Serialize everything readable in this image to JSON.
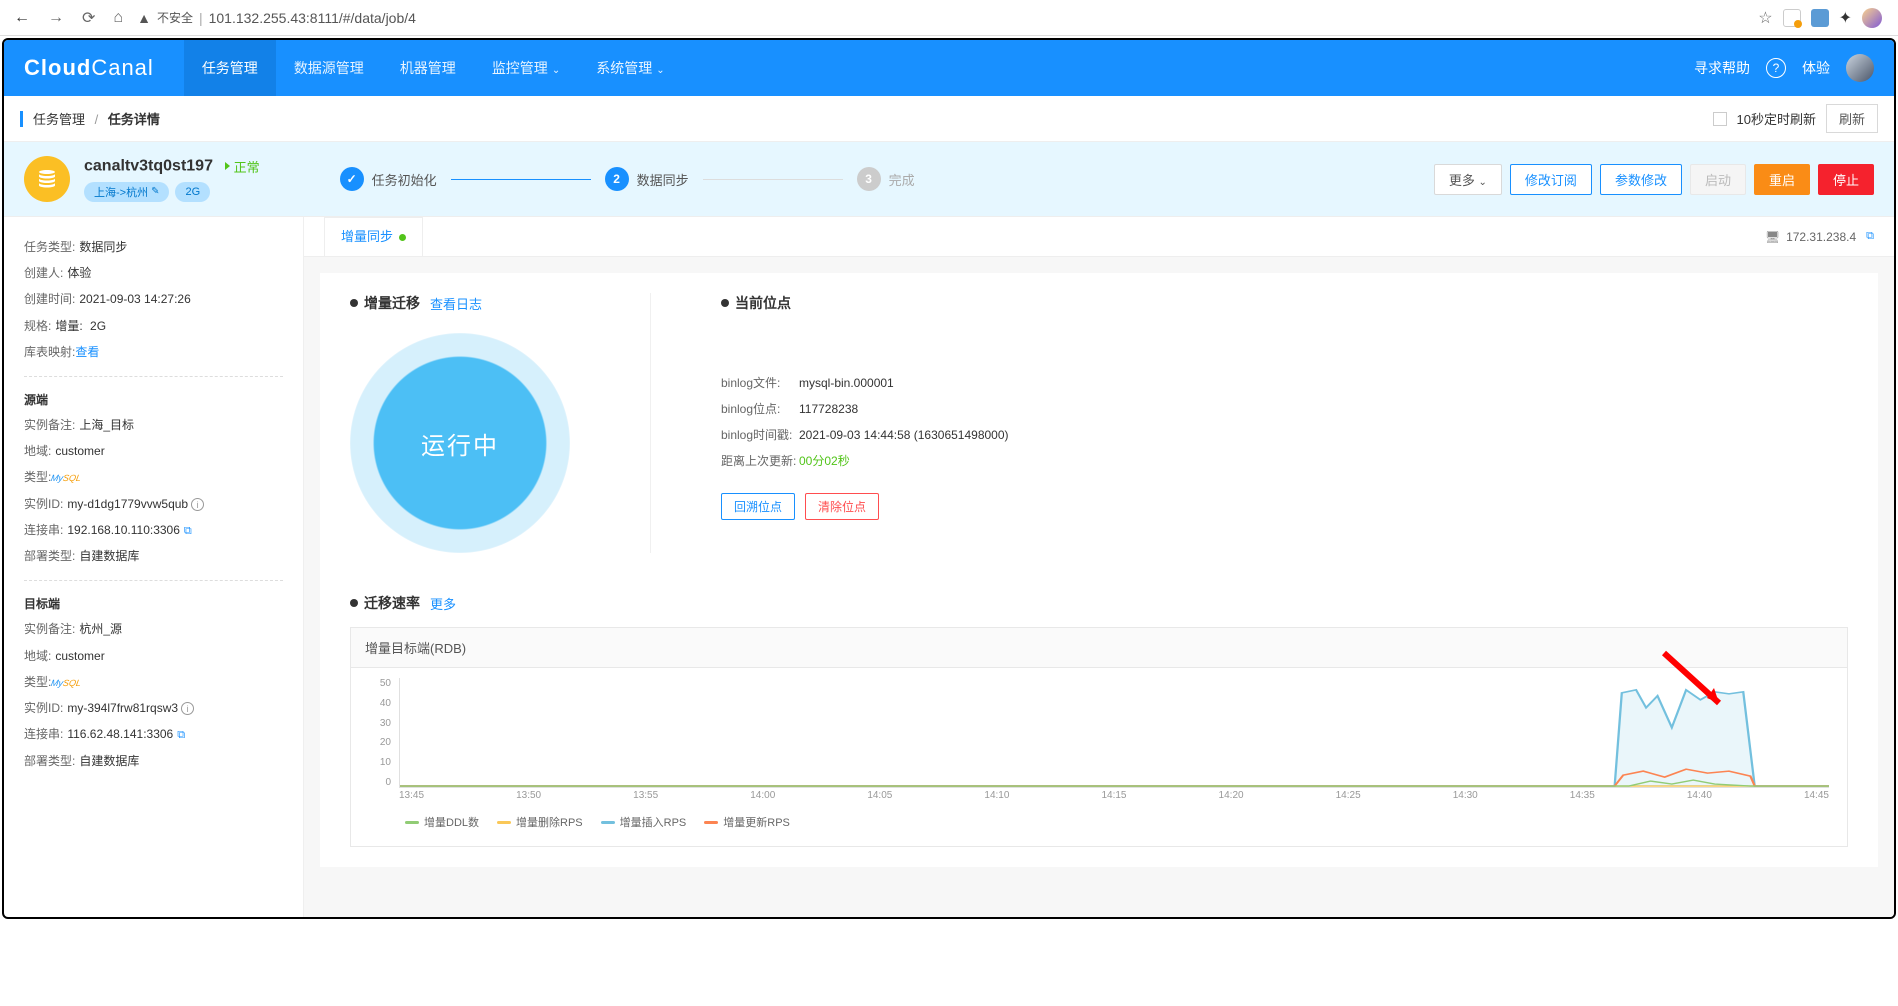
{
  "browser": {
    "url_prefix": "不安全",
    "url": "101.132.255.43:8111/#/data/job/4"
  },
  "header": {
    "logo_a": "Cloud",
    "logo_b": "Canal",
    "nav": [
      "任务管理",
      "数据源管理",
      "机器管理",
      "监控管理",
      "系统管理"
    ],
    "help": "寻求帮助",
    "user_label": "体验"
  },
  "breadcrumb": {
    "root": "任务管理",
    "current": "任务详情"
  },
  "bc_actions": {
    "auto_refresh": "10秒定时刷新",
    "refresh": "刷新"
  },
  "banner": {
    "job_name": "canaltv3tq0st197",
    "status": "正常",
    "tags": {
      "route": "上海->杭州",
      "spec": "2G"
    },
    "steps": {
      "s1": "任务初始化",
      "s2": "数据同步",
      "s3": "完成"
    },
    "btns": {
      "more": "更多",
      "sub": "修改订阅",
      "param": "参数修改",
      "start": "启动",
      "restart": "重启",
      "stop": "停止"
    }
  },
  "sidebar": {
    "task_type_lbl": "任务类型:",
    "task_type": "数据同步",
    "creator_lbl": "创建人:",
    "creator": "体验",
    "ctime_lbl": "创建时间:",
    "ctime": "2021-09-03 14:27:26",
    "spec_lbl": "规格:",
    "spec_k": "增量:",
    "spec_v": "2G",
    "mapping_lbl": "库表映射:",
    "mapping_link": "查看",
    "src_heading": "源端",
    "src": {
      "remark_lbl": "实例备注:",
      "remark": "上海_目标",
      "region_lbl": "地域:",
      "region": "customer",
      "type_lbl": "类型:",
      "type": "MySQL",
      "id_lbl": "实例ID:",
      "id": "my-d1dg1779vvw5qub",
      "conn_lbl": "连接串:",
      "conn": "192.168.10.110:3306",
      "deploy_lbl": "部署类型:",
      "deploy": "自建数据库"
    },
    "dst_heading": "目标端",
    "dst": {
      "remark_lbl": "实例备注:",
      "remark": "杭州_源",
      "region_lbl": "地域:",
      "region": "customer",
      "type_lbl": "类型:",
      "type": "MySQL",
      "id_lbl": "实例ID:",
      "id": "my-394l7frw81rqsw3",
      "conn_lbl": "连接串:",
      "conn": "116.62.48.141:3306",
      "deploy_lbl": "部署类型:",
      "deploy": "自建数据库"
    }
  },
  "tab": {
    "label": "增量同步",
    "server_ip": "172.31.238.4"
  },
  "migrate": {
    "title": "增量迁移",
    "log_link": "查看日志",
    "status": "运行中"
  },
  "position": {
    "title": "当前位点",
    "file_lbl": "binlog文件:",
    "file": "mysql-bin.000001",
    "pos_lbl": "binlog位点:",
    "pos": "117728238",
    "ts_lbl": "binlog时间戳:",
    "ts": "2021-09-03 14:44:58  (1630651498000)",
    "since_lbl": "距离上次更新:",
    "since": "00分02秒",
    "btn_rollback": "回溯位点",
    "btn_clear": "清除位点"
  },
  "rate": {
    "title": "迁移速率",
    "more": "更多"
  },
  "chart_data": {
    "type": "line",
    "title": "增量目标端(RDB)",
    "ylabel": "",
    "ylim": [
      0,
      50
    ],
    "y_ticks": [
      "50",
      "40",
      "30",
      "20",
      "10",
      "0"
    ],
    "x_ticks": [
      "13:45",
      "13:50",
      "13:55",
      "14:00",
      "14:05",
      "14:10",
      "14:15",
      "14:20",
      "14:25",
      "14:30",
      "14:35",
      "14:40",
      "14:45"
    ],
    "series": [
      {
        "name": "增量DDL数",
        "color": "#91cc75",
        "values_desc": "flat 0, brief pulse ~14:38"
      },
      {
        "name": "增量删除RPS",
        "color": "#fac858",
        "values_desc": "flat 0"
      },
      {
        "name": "增量插入RPS",
        "color": "#73c0de",
        "values_desc": "0 until ~14:36 then jumps to ~45 with dips, drops at ~14:43"
      },
      {
        "name": "增量更新RPS",
        "color": "#fc8452",
        "values_desc": "0 until ~14:36 then low ~5-8, drops at ~14:43"
      }
    ]
  },
  "legend": {
    "ddl": "增量DDL数",
    "del": "增量删除RPS",
    "ins": "增量插入RPS",
    "upd": "增量更新RPS"
  }
}
